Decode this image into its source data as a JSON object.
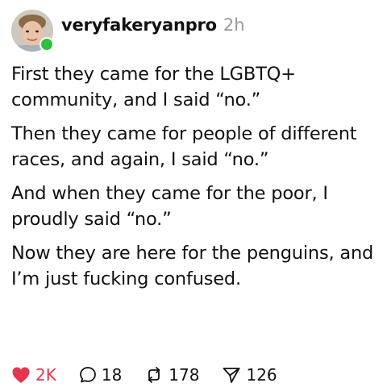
{
  "post": {
    "author": "veryfakeryanpro",
    "time_ago": "2h",
    "paragraphs": [
      "First they came for the LGBTQ+ community, and I said “no.”",
      "Then they came for people of different races, and again, I said “no.”",
      "And when they came for the poor, I proudly said “no.”",
      "Now they are here for the penguins, and I’m just fucking confused."
    ]
  },
  "actions": {
    "likes": "2K",
    "replies": "18",
    "reposts": "178",
    "shares": "126"
  },
  "colors": {
    "like": "#e8344c",
    "online": "#2ec23c",
    "muted": "#999999"
  },
  "icons": {
    "like": "heart-icon",
    "reply": "comment-icon",
    "repost": "repost-icon",
    "share": "send-icon"
  }
}
